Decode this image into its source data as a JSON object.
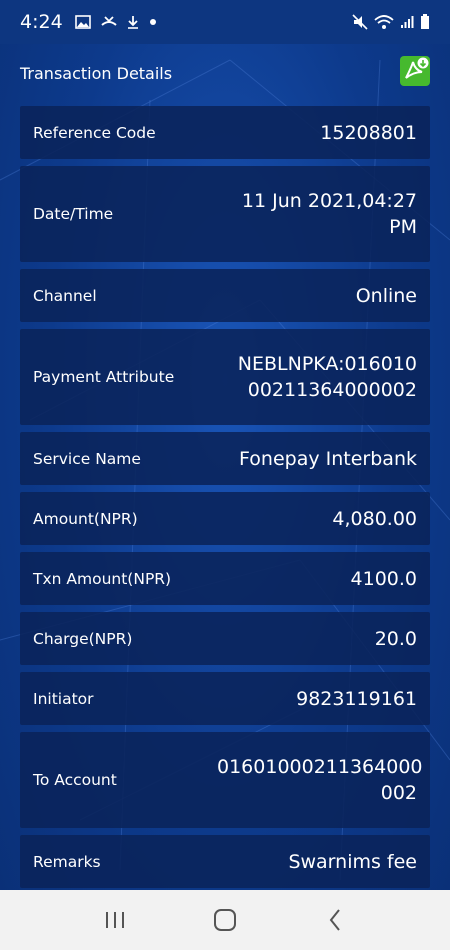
{
  "status_bar": {
    "time": "4:24",
    "left_icons": [
      "image-icon",
      "missed-call-icon",
      "download-icon",
      "dot-icon"
    ],
    "right_icons": [
      "mute-icon",
      "wifi-icon",
      "signal-icon",
      "battery-icon"
    ]
  },
  "header": {
    "title": "Transaction Details",
    "pdf_icon": "pdf-download-icon",
    "pdf_color": "#46b92e"
  },
  "details": [
    {
      "label": "Reference Code",
      "value": "15208801"
    },
    {
      "label": "Date/Time",
      "value": "11 Jun 2021,04:27 PM"
    },
    {
      "label": "Channel",
      "value": "Online"
    },
    {
      "label": "Payment Attribute",
      "value": "NEBLNPKA:016010 00211364000002"
    },
    {
      "label": "Service Name",
      "value": "Fonepay Interbank"
    },
    {
      "label": "Amount(NPR)",
      "value": "4,080.00"
    },
    {
      "label": "Txn Amount(NPR)",
      "value": "4100.0"
    },
    {
      "label": "Charge(NPR)",
      "value": "20.0"
    },
    {
      "label": "Initiator",
      "value": "9823119161"
    },
    {
      "label": "To Account",
      "value": "01601000211364000 002"
    },
    {
      "label": "Remarks",
      "value": "Swarnims fee"
    }
  ],
  "nav_bar": {
    "recents_icon": "recents-icon",
    "home_icon": "home-icon",
    "back_icon": "back-icon"
  }
}
